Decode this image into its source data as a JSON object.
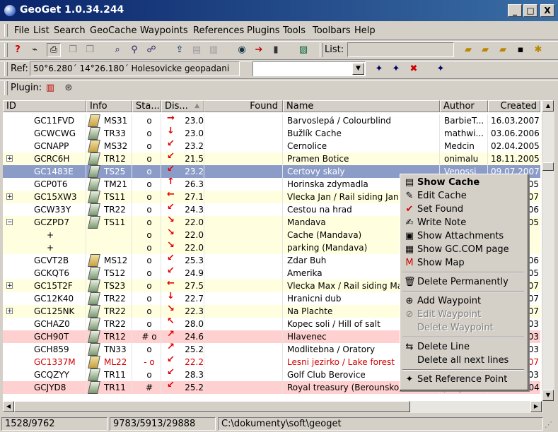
{
  "window": {
    "title": "GeoGet 1.0.34.244",
    "min": "_",
    "max": "□",
    "close": "X"
  },
  "menu": [
    "File",
    "List",
    "Search",
    "GeoCache",
    "Waypoints",
    "References",
    "Plugins",
    "Tools",
    "Toolbars",
    "Help"
  ],
  "toolbar": {
    "list_label": "List:",
    "list_value": ""
  },
  "reference": {
    "label": "Ref:",
    "value": "50°6.280´ 14°26.180´ Holesovicke geopadani",
    "combo_value": ""
  },
  "plugin": {
    "label": "Plugin:"
  },
  "columns": [
    "ID",
    "Info",
    "Sta...",
    "Dis...",
    "Found",
    "Name",
    "Author",
    "Created"
  ],
  "rows": [
    {
      "id": "GC11FVD",
      "info": "MS31",
      "icon": "multi",
      "status": "o",
      "arrow": "→",
      "dist": "23.0",
      "name": "Barvoslepá / Colourblind",
      "author": "BarbieT...",
      "created": "16.03.2007",
      "bg": "#ffffff",
      "exp": ""
    },
    {
      "id": "GCWCWG",
      "info": "TR33",
      "icon": "trad",
      "status": "o",
      "arrow": "↓",
      "dist": "23.0",
      "name": "Bužlík Cache",
      "author": "mathwi...",
      "created": "03.06.2006",
      "bg": "#ffffff",
      "exp": ""
    },
    {
      "id": "GCNAPP",
      "info": "MS32",
      "icon": "multi",
      "status": "o",
      "arrow": "↙",
      "dist": "23.2",
      "name": "Cernolice",
      "author": "Medcin",
      "created": "02.04.2005",
      "bg": "#ffffff",
      "exp": ""
    },
    {
      "id": "GCRC6H",
      "info": "TR12",
      "icon": "trad",
      "status": "o",
      "arrow": "↙",
      "dist": "21.5",
      "name": "Pramen Botice",
      "author": "onimalu",
      "created": "18.11.2005",
      "bg": "#ffffe0",
      "exp": "+"
    },
    {
      "id": "GC1483E",
      "info": "TS25",
      "icon": "trad",
      "status": "o",
      "arrow": "↙",
      "dist": "23.2",
      "name": "Certovy skaly",
      "author": "Venossi",
      "created": "09.07.2007",
      "bg": "#8c9cc8",
      "exp": "",
      "selected": true
    },
    {
      "id": "GCP0T6",
      "info": "TM21",
      "icon": "trad",
      "status": "o",
      "arrow": "↑",
      "dist": "26.3",
      "name": "Horinska zdymadla",
      "author": "",
      "created": "05",
      "bg": "#ffffff",
      "exp": ""
    },
    {
      "id": "GC15XW3",
      "info": "TS11",
      "icon": "trad",
      "status": "o",
      "arrow": "←",
      "dist": "27.1",
      "name": "Vlecka Jan / Rail siding Jan",
      "author": "",
      "created": "07",
      "bg": "#ffffe0",
      "exp": "+"
    },
    {
      "id": "GCW33Y",
      "info": "TR22",
      "icon": "trad",
      "status": "o",
      "arrow": "↙",
      "dist": "24.3",
      "name": "Cestou na hrad",
      "author": "",
      "created": "06",
      "bg": "#ffffff",
      "exp": ""
    },
    {
      "id": "GCZPD7",
      "info": "TS11",
      "icon": "trad",
      "status": "o",
      "arrow": "↘",
      "dist": "22.0",
      "name": "Mandava",
      "author": "",
      "created": "05",
      "bg": "#ffffe0",
      "exp": "−"
    },
    {
      "id": "+",
      "info": "",
      "icon": "",
      "status": "o",
      "arrow": "↘",
      "dist": "22.0",
      "name": "Cache (Mandava)",
      "author": "",
      "created": "",
      "bg": "#ffffe0",
      "exp": "",
      "child": true
    },
    {
      "id": "+",
      "info": "",
      "icon": "",
      "status": "o",
      "arrow": "↘",
      "dist": "22.0",
      "name": "parking (Mandava)",
      "author": "",
      "created": "",
      "bg": "#ffffe0",
      "exp": "",
      "child": true
    },
    {
      "id": "GCVT2B",
      "info": "MS12",
      "icon": "multi",
      "status": "o",
      "arrow": "↙",
      "dist": "25.3",
      "name": "Zdar Buh",
      "author": "",
      "created": "06",
      "bg": "#ffffff",
      "exp": ""
    },
    {
      "id": "GCKQT6",
      "info": "TS12",
      "icon": "trad",
      "status": "o",
      "arrow": "↙",
      "dist": "24.9",
      "name": "Amerika",
      "author": "",
      "created": "05",
      "bg": "#ffffff",
      "exp": ""
    },
    {
      "id": "GC15T2F",
      "info": "TS23",
      "icon": "trad",
      "status": "o",
      "arrow": "←",
      "dist": "27.5",
      "name": "Vlecka Max / Rail siding Max",
      "author": "",
      "created": "07",
      "bg": "#ffffe0",
      "exp": "+"
    },
    {
      "id": "GC12K40",
      "info": "TR22",
      "icon": "trad",
      "status": "o",
      "arrow": "↓",
      "dist": "22.7",
      "name": "Hranicni dub",
      "author": "",
      "created": "07",
      "bg": "#ffffff",
      "exp": ""
    },
    {
      "id": "GC125NK",
      "info": "TR22",
      "icon": "trad",
      "status": "o",
      "arrow": "↘",
      "dist": "22.3",
      "name": "Na Plachte",
      "author": "",
      "created": "07",
      "bg": "#ffffe0",
      "exp": "+"
    },
    {
      "id": "GCHAZ0",
      "info": "TR22",
      "icon": "trad",
      "status": "o",
      "arrow": "↖",
      "dist": "28.0",
      "name": "Kopec soli / Hill of salt",
      "author": "",
      "created": "03",
      "bg": "#ffffff",
      "exp": ""
    },
    {
      "id": "GCH90T",
      "info": "TR12",
      "icon": "trad",
      "status": "# o",
      "arrow": "↗",
      "dist": "24.6",
      "name": "Hlavenec",
      "author": "",
      "created": "03",
      "bg": "#ffd0d0",
      "exp": ""
    },
    {
      "id": "GCH859",
      "info": "TN33",
      "icon": "trad",
      "status": "o",
      "arrow": "↗",
      "dist": "25.2",
      "name": "Modlitebna / Oratory",
      "author": "",
      "created": "03",
      "bg": "#ffffff",
      "exp": ""
    },
    {
      "id": "GC1337M",
      "info": "ML22",
      "icon": "multi",
      "status": "- o",
      "arrow": "↙",
      "dist": "22.2",
      "name": "Lesni jezirko / Lake forest",
      "author": "",
      "created": "07",
      "bg": "#ffffff",
      "exp": "",
      "red": true
    },
    {
      "id": "GCQZYY",
      "info": "TR11",
      "icon": "trad",
      "status": "o",
      "arrow": "↙",
      "dist": "28.3",
      "name": "Golf Club Berovice",
      "author": "",
      "created": "03",
      "bg": "#ffffff",
      "exp": ""
    },
    {
      "id": "GCJYD8",
      "info": "TR11",
      "icon": "trad",
      "status": "#",
      "arrow": "↙",
      "dist": "25.2",
      "name": "Royal treasury (Berounsko)",
      "author": "Jarry",
      "created": "09.07.2004",
      "bg": "#ffd0d0",
      "exp": ""
    }
  ],
  "context_menu": [
    {
      "label": "Show Cache",
      "icon": "show-cache-icon",
      "glyph": "▤",
      "bold": true,
      "disabled": false
    },
    {
      "label": "Edit Cache",
      "icon": "edit-cache-icon",
      "glyph": "✎",
      "disabled": false
    },
    {
      "label": "Set Found",
      "icon": "checkmark-icon",
      "glyph": "✔",
      "disabled": false,
      "color": "#d00000"
    },
    {
      "label": "Write Note",
      "icon": "note-icon",
      "glyph": "✍",
      "disabled": false
    },
    {
      "label": "Show Attachments",
      "icon": "attachments-icon",
      "glyph": "▣",
      "disabled": false
    },
    {
      "label": "Show GC.COM page",
      "icon": "gccom-icon",
      "glyph": "▦",
      "disabled": false
    },
    {
      "label": "Show Map",
      "icon": "map-icon",
      "glyph": "M",
      "disabled": false,
      "color": "#d00000"
    },
    {
      "sep": true
    },
    {
      "label": "Delete Permanently",
      "icon": "trash-icon",
      "glyph": "🗑",
      "disabled": false
    },
    {
      "sep": true
    },
    {
      "label": "Add Waypoint",
      "icon": "add-waypoint-icon",
      "glyph": "⊕",
      "disabled": false
    },
    {
      "label": "Edit Waypoint",
      "icon": "edit-waypoint-icon",
      "glyph": "⊘",
      "disabled": true
    },
    {
      "label": "Delete Waypoint",
      "icon": "delete-waypoint-icon",
      "glyph": "",
      "disabled": true
    },
    {
      "sep": true
    },
    {
      "label": "Delete Line",
      "icon": "delete-line-icon",
      "glyph": "⇆",
      "disabled": false
    },
    {
      "label": "Delete all next lines",
      "icon": "",
      "glyph": "",
      "disabled": false
    },
    {
      "sep": true
    },
    {
      "label": "Set Reference Point",
      "icon": "reference-point-icon",
      "glyph": "✦",
      "disabled": false
    }
  ],
  "status": {
    "count": "1528/9762",
    "stats": "9783/5913/29888",
    "path": "C:\\dokumenty\\soft\\geoget"
  },
  "colors": {
    "titlebar": "#0a246a",
    "selected_row": "#8c9cc8",
    "yellow_row": "#ffffe0",
    "pink_row": "#ffd0d0",
    "red_text": "#d00000"
  }
}
